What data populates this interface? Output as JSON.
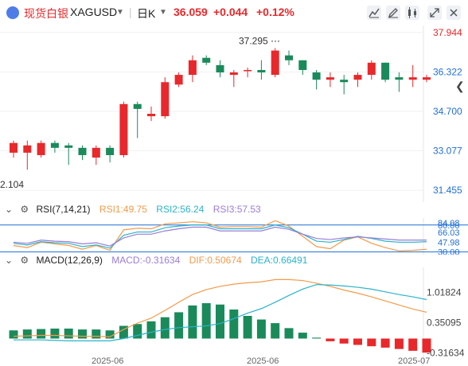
{
  "header": {
    "name": "现货白银",
    "symbol": "XAGUSD",
    "dropdown_icon": "caret-down-icon",
    "period": "日K",
    "price": "36.059",
    "change": "+0.044",
    "change_pct": "+0.12%",
    "up_color": "#e8282b",
    "down_color": "#1a8a5a",
    "tools": [
      "line-chart-icon",
      "draw-pencil-icon",
      "candlestick-type-icon",
      "expand-icon",
      "close-icon"
    ]
  },
  "side_toggle": "chevron-left-icon",
  "chart_data": [
    {
      "type": "candlestick",
      "y_ticks": [
        "37.944",
        "36.322",
        "34.700",
        "33.077",
        "31.455"
      ],
      "ylim": [
        31.1,
        38.1
      ],
      "x_ticks": [
        "2025-06",
        "2025-06",
        "2025-07"
      ],
      "annotations": {
        "high_label": "37.295",
        "low_label": "2.104"
      },
      "candles": [
        [
          33.0,
          33.4,
          32.8,
          33.5
        ],
        [
          33.0,
          33.3,
          32.3,
          33.5
        ],
        [
          32.9,
          33.4,
          32.8,
          33.5
        ],
        [
          33.4,
          33.2,
          33.0,
          33.5
        ],
        [
          33.3,
          33.2,
          32.5,
          33.4
        ],
        [
          33.2,
          32.9,
          32.7,
          33.3
        ],
        [
          32.8,
          33.2,
          32.5,
          33.3
        ],
        [
          33.2,
          32.9,
          32.6,
          33.3
        ],
        [
          32.9,
          35.0,
          32.8,
          35.1
        ],
        [
          35.0,
          34.8,
          33.6,
          35.1
        ],
        [
          34.5,
          34.6,
          34.3,
          34.9
        ],
        [
          34.5,
          35.9,
          34.4,
          36.1
        ],
        [
          35.8,
          36.2,
          35.7,
          36.3
        ],
        [
          36.2,
          36.8,
          35.9,
          37.0
        ],
        [
          36.9,
          36.7,
          36.6,
          37.0
        ],
        [
          36.6,
          36.3,
          36.1,
          36.8
        ],
        [
          36.2,
          36.3,
          35.7,
          36.4
        ],
        [
          36.4,
          36.4,
          36.1,
          36.5
        ],
        [
          36.4,
          36.3,
          36.0,
          36.8
        ],
        [
          36.2,
          37.2,
          36.1,
          37.3
        ],
        [
          37.0,
          36.8,
          36.6,
          37.2
        ],
        [
          36.8,
          36.4,
          36.2,
          36.8
        ],
        [
          36.3,
          36.0,
          35.6,
          36.4
        ],
        [
          36.0,
          36.1,
          35.7,
          36.3
        ],
        [
          36.0,
          35.9,
          35.4,
          36.2
        ],
        [
          36.0,
          36.2,
          35.7,
          36.3
        ],
        [
          36.2,
          36.7,
          36.0,
          36.8
        ],
        [
          36.7,
          36.0,
          35.9,
          36.7
        ],
        [
          36.1,
          36.0,
          35.5,
          36.3
        ],
        [
          36.0,
          36.1,
          35.7,
          36.6
        ],
        [
          36.0,
          36.1,
          35.9,
          36.2
        ]
      ]
    },
    {
      "type": "line",
      "title": "RSI(7,14,21)",
      "y_ticks": [
        "80.00",
        "84.08",
        "66.03",
        "47.98",
        "30.00"
      ],
      "ylim": [
        28,
        90
      ],
      "series": [
        {
          "name": "RSI1:49.75",
          "color": "#f29b4b",
          "values": [
            42,
            38,
            48,
            45,
            42,
            35,
            42,
            33,
            71,
            74,
            73,
            82,
            84,
            86,
            84,
            76,
            77,
            77,
            76,
            88,
            78,
            59,
            40,
            36,
            52,
            58,
            46,
            38,
            32,
            33,
            35
          ]
        },
        {
          "name": "RSI2:56.24",
          "color": "#2bb3c9",
          "values": [
            46,
            43,
            49,
            47,
            46,
            40,
            43,
            37,
            61,
            67,
            67,
            75,
            78,
            80,
            80,
            73,
            73,
            73,
            73,
            80,
            75,
            63,
            50,
            48,
            53,
            59,
            55,
            50,
            48,
            48,
            49
          ]
        },
        {
          "name": "RSI3:57.53",
          "color": "#9a7dd4",
          "values": [
            48,
            46,
            52,
            50,
            49,
            45,
            47,
            41,
            56,
            63,
            63,
            69,
            73,
            76,
            76,
            69,
            69,
            69,
            69,
            76,
            72,
            63,
            55,
            53,
            56,
            58,
            56,
            54,
            52,
            52,
            52
          ]
        }
      ],
      "levels": [
        80,
        30
      ]
    },
    {
      "type": "bar",
      "title": "MACD(12,26,9)",
      "y_ticks": [
        "1.01824",
        "0.35095",
        "-0.31634"
      ],
      "ylim": [
        -0.5,
        1.5
      ],
      "series": [
        {
          "name": "MACD:-0.31634",
          "color": "#9a7dd4",
          "values": [
            0.18,
            0.2,
            0.21,
            0.22,
            0.22,
            0.2,
            0.2,
            0.18,
            0.28,
            0.32,
            0.38,
            0.47,
            0.58,
            0.73,
            0.78,
            0.75,
            0.64,
            0.5,
            0.42,
            0.34,
            0.23,
            0.13,
            0.02,
            -0.06,
            -0.11,
            -0.14,
            -0.17,
            -0.2,
            -0.23,
            -0.27,
            -0.31
          ]
        },
        {
          "name": "DIF:0.50674",
          "color": "#f29b4b",
          "values": [
            0.05,
            0.06,
            0.07,
            0.07,
            0.06,
            0.05,
            0.05,
            0.04,
            0.2,
            0.34,
            0.45,
            0.62,
            0.8,
            0.97,
            1.08,
            1.15,
            1.2,
            1.23,
            1.25,
            1.3,
            1.3,
            1.28,
            1.22,
            1.15,
            1.07,
            1.0,
            0.92,
            0.83,
            0.74,
            0.65,
            0.58
          ]
        },
        {
          "name": "DEA:0.66491",
          "color": "#2bb3c9",
          "values": [
            -0.03,
            -0.03,
            -0.03,
            -0.04,
            -0.05,
            -0.05,
            -0.05,
            -0.05,
            -0.0,
            0.07,
            0.14,
            0.2,
            0.24,
            0.26,
            0.28,
            0.33,
            0.44,
            0.56,
            0.66,
            0.8,
            0.95,
            1.09,
            1.19,
            1.18,
            1.16,
            1.13,
            1.09,
            1.03,
            0.97,
            0.92,
            0.86
          ]
        }
      ]
    }
  ]
}
